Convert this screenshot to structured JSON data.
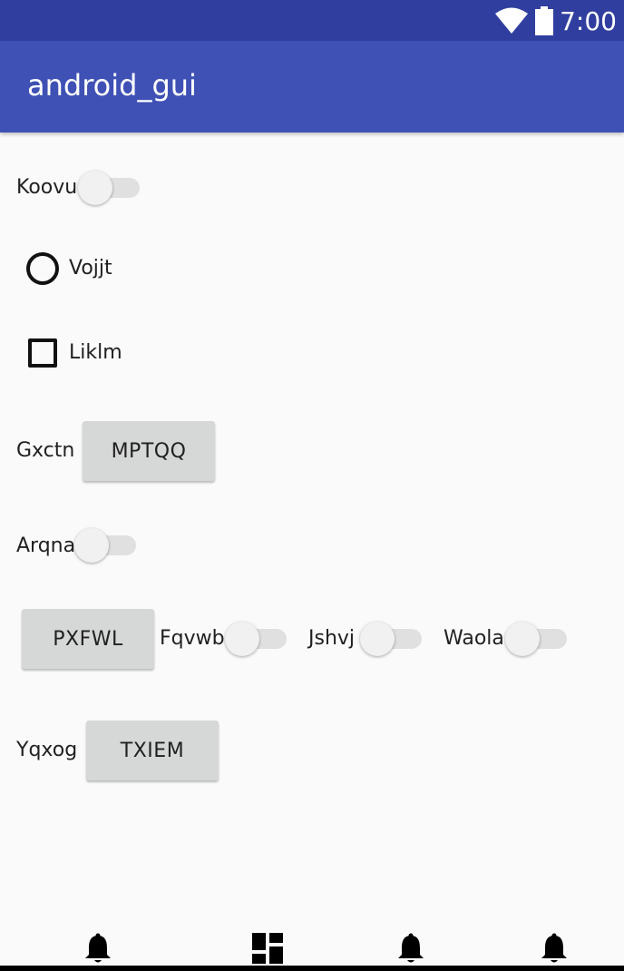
{
  "status_bar": {
    "time": "7:00",
    "wifi_icon": "wifi-icon",
    "battery_icon": "battery-icon"
  },
  "app_bar": {
    "title": "android_gui"
  },
  "form": {
    "switch_koovu": {
      "label": "Koovu"
    },
    "radio_vojjt": {
      "label": "Vojjt"
    },
    "checkbox_liklm": {
      "label": "Liklm"
    },
    "row_gxctn": {
      "label": "Gxctn",
      "button": "MPTQQ"
    },
    "switch_arqna": {
      "label": "Arqna"
    },
    "row_pxfwl": {
      "button": "PXFWL",
      "switches": [
        {
          "label": "Fqvwb"
        },
        {
          "label": "Jshvj"
        },
        {
          "label": "Waola"
        }
      ]
    },
    "row_yqxog": {
      "label": "Yqxog",
      "button": "TXIEM"
    }
  },
  "bottom_nav": {
    "items": [
      {
        "icon": "bell-icon"
      },
      {
        "icon": "dashboard-icon"
      },
      {
        "icon": "bell-icon"
      },
      {
        "icon": "bell-icon"
      }
    ]
  }
}
